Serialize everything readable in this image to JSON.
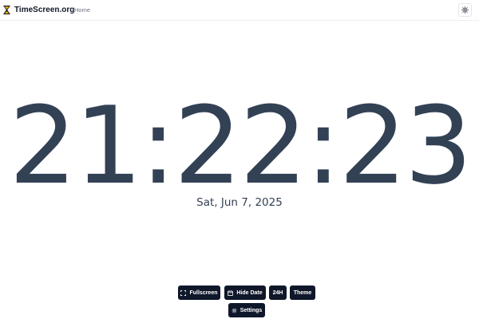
{
  "header": {
    "brand": "TimeScreen.org",
    "nav_home": "Home",
    "logo_icon": "hourglass-logo-icon",
    "theme_toggle_icon": "sun-icon"
  },
  "clock": {
    "time": "21:22:23",
    "date": "Sat, Jun 7, 2025"
  },
  "controls": {
    "fullscreen_label": "Fullscreen",
    "hide_date_label": "Hide Date",
    "format_label": "24H",
    "theme_label": "Theme",
    "settings_label": "Settings"
  },
  "colors": {
    "clock_text": "#334155",
    "button_bg": "#0f172a",
    "button_text": "#ffffff",
    "brand_text": "#111827",
    "nav_text": "#6b7280"
  }
}
